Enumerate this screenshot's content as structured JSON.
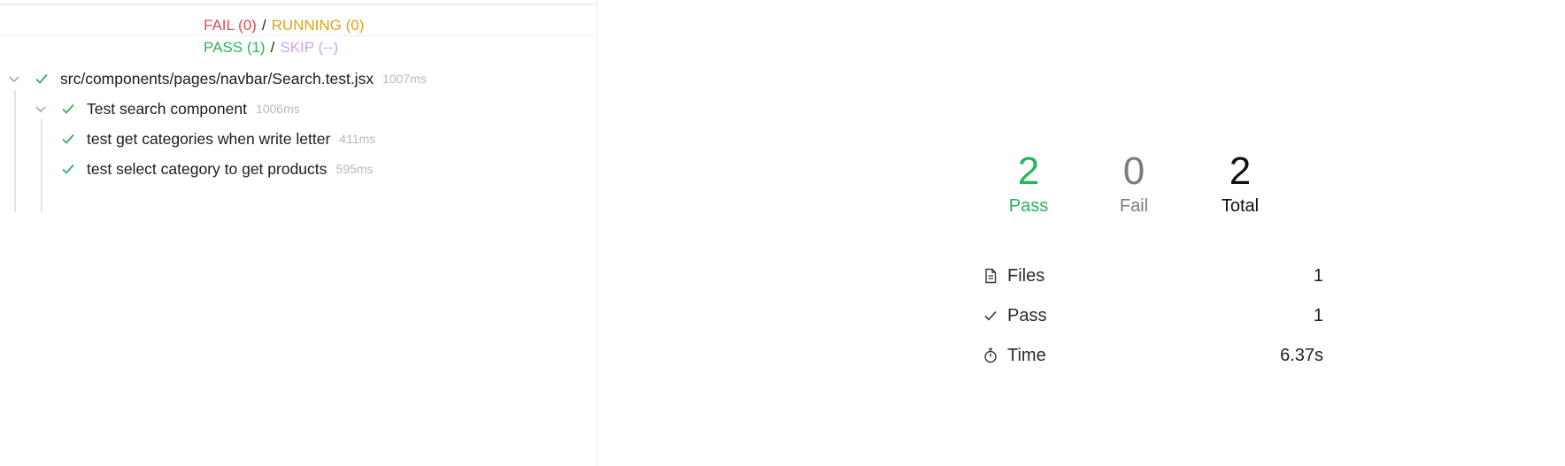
{
  "filters": {
    "fail_label": "FAIL (0)",
    "running_label": "RUNNING (0)",
    "pass_label": "PASS (1)",
    "skip_label": "SKIP (--)",
    "separator": "/"
  },
  "tree": {
    "file": {
      "name": "src/components/pages/navbar/Search.test.jsx",
      "duration": "1007ms",
      "status": "pass"
    },
    "suite": {
      "name": "Test search component",
      "duration": "1006ms",
      "status": "pass"
    },
    "tests": [
      {
        "name": "test get categories when write letter",
        "duration": "411ms",
        "status": "pass"
      },
      {
        "name": "test select category to get products",
        "duration": "595ms",
        "status": "pass"
      }
    ]
  },
  "summary": {
    "pass": {
      "value": "2",
      "label": "Pass"
    },
    "fail": {
      "value": "0",
      "label": "Fail"
    },
    "total": {
      "value": "2",
      "label": "Total"
    },
    "metrics": [
      {
        "icon": "file-icon",
        "label": "Files",
        "value": "1"
      },
      {
        "icon": "check-icon",
        "label": "Pass",
        "value": "1"
      },
      {
        "icon": "stopwatch-icon",
        "label": "Time",
        "value": "6.37s"
      }
    ]
  },
  "colors": {
    "fail": "#e5484d",
    "running": "#e0a417",
    "pass": "#2fb35c",
    "skip": "#c8a6ef",
    "muted": "#b9b9b9"
  }
}
